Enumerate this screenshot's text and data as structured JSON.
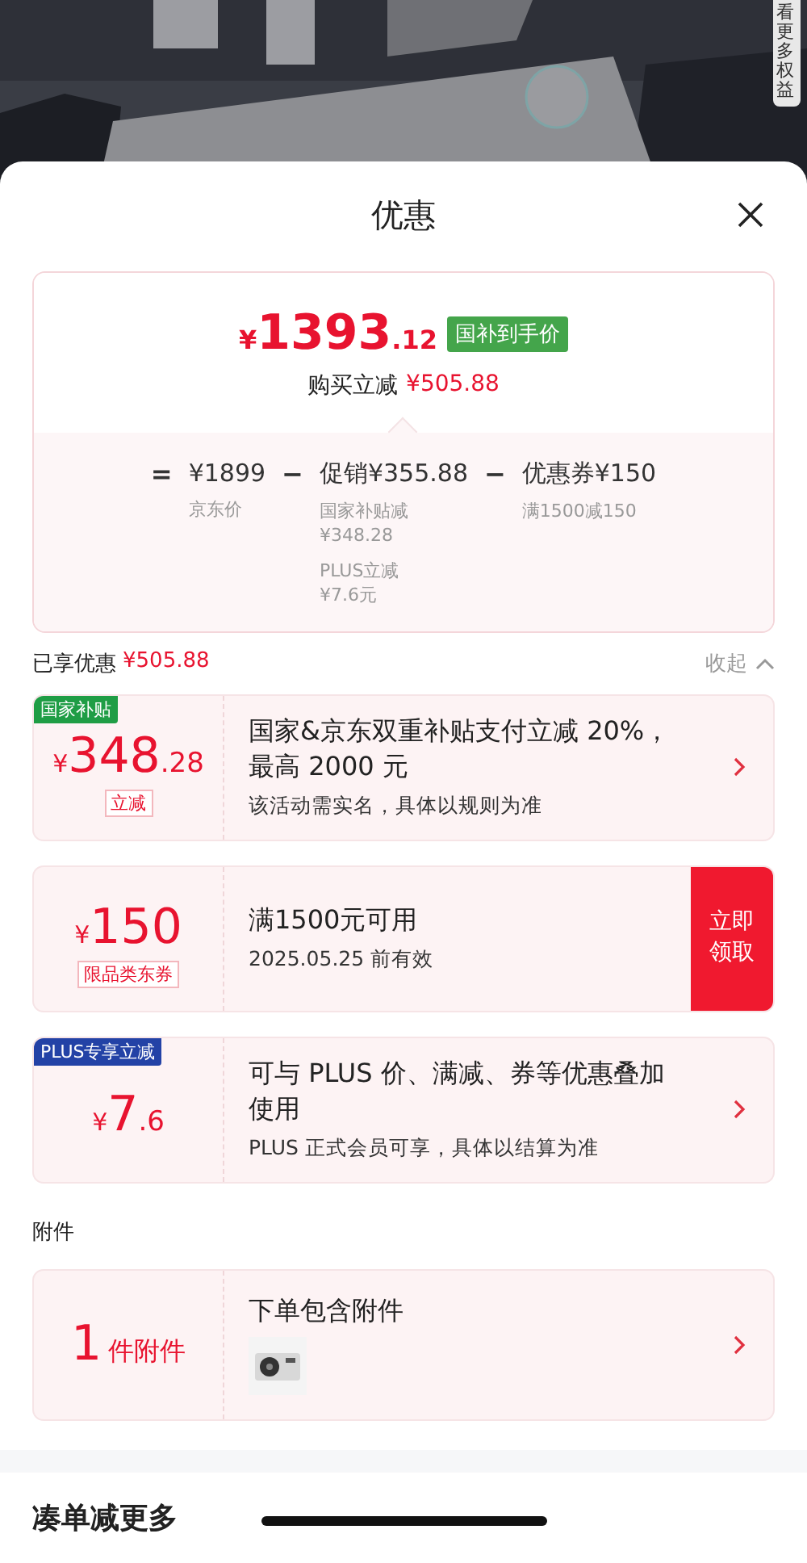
{
  "banner": {
    "kind": "picture",
    "side_tab": "看更多权益"
  },
  "sheet": {
    "title": "优惠"
  },
  "summary": {
    "price_symbol": "¥",
    "price_integer": "1393",
    "price_decimal": ".12",
    "price_tag": "国补到手价",
    "saving_label": "购买立减",
    "saving_amount": "¥505.88",
    "formula": [
      {
        "kind": "op",
        "text": "="
      },
      {
        "kind": "term",
        "text": "¥1899",
        "notes": [
          {
            "label": "京东价"
          }
        ]
      },
      {
        "kind": "op",
        "text": "−"
      },
      {
        "kind": "term",
        "text": "促销¥355.88",
        "notes": [
          {
            "label": "国家补贴减",
            "amount": "¥348.28"
          },
          {
            "label": "PLUS立减",
            "amount": "¥7.6元"
          }
        ]
      },
      {
        "kind": "op",
        "text": "−"
      },
      {
        "kind": "term",
        "text": "优惠券¥150",
        "notes": [
          {
            "label": "满1500减150"
          }
        ]
      }
    ]
  },
  "enjoyed": {
    "label": "已享优惠",
    "amount": "¥505.88",
    "toggle": "收起",
    "expanded": true
  },
  "offers": [
    {
      "kind": "subsidy",
      "tag": {
        "text": "国家补贴",
        "color": "#1f9d45"
      },
      "symbol": "¥",
      "integer": "348",
      "decimal": ".28",
      "unit_tag": "立减",
      "title": "国家&京东双重补贴支付立减 20%，最高 2000 元",
      "subtitle": "该活动需实名，具体以规则为准"
    },
    {
      "kind": "coupon",
      "symbol": "¥",
      "integer": "150",
      "unit_tag": "限品类东券",
      "title": "满1500元可用",
      "subtitle": "2025.05.25 前有效",
      "action": "立即领取"
    },
    {
      "kind": "plus",
      "tag": {
        "text": "PLUS专享立减",
        "color": "#2342a6"
      },
      "symbol": "¥",
      "integer": "7",
      "decimal": ".6",
      "title": "可与 PLUS 价、满减、券等优惠叠加使用",
      "subtitle": "PLUS 正式会员可享，具体以结算为准"
    }
  ],
  "accessories": {
    "heading": "附件",
    "count": "1",
    "unit": "件附件",
    "title": "下单包含附件"
  },
  "more": {
    "heading": "凑单减更多"
  }
}
